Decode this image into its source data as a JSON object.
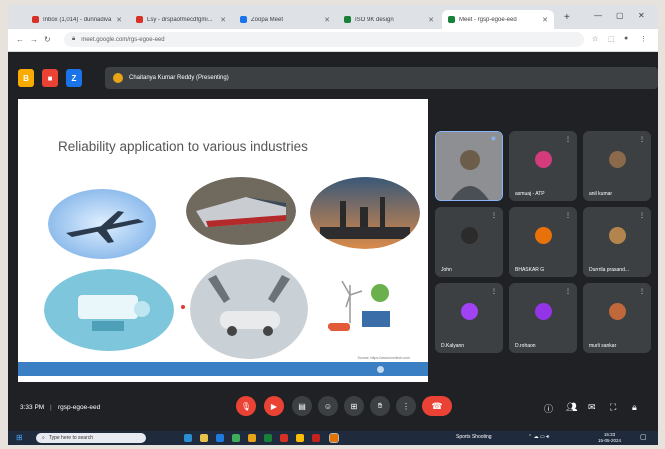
{
  "browser": {
    "tabs": [
      {
        "title": "Inbox (1,014) - dunnadiva",
        "color": "#d93025"
      },
      {
        "title": "Lsy - drspaofmecdfgmi...",
        "color": "#d93025"
      },
      {
        "title": "Zoopa Meet",
        "color": "#1a73e8"
      },
      {
        "title": "ISO 9K design",
        "color": "#188038"
      },
      {
        "title": "Meet - rgsp-egoe-eed",
        "color": "#188038"
      }
    ],
    "new_tab": "+",
    "window_controls": {
      "minimize": "—",
      "maximize": "▢",
      "close": "✕"
    },
    "url": "meet.google.com/rgs-egoe-eed"
  },
  "meet": {
    "presenter_label": "Chaitanya Kumar Reddy (Presenting)",
    "top_buttons": [
      {
        "label": "B",
        "color": "#f9ab00"
      },
      {
        "label": "■",
        "color": "#ea4335"
      },
      {
        "label": "Z",
        "color": "#1a73e8"
      }
    ],
    "slide": {
      "title": "Reliability application to various industries",
      "caption": "Source: https://www.iomitech.com"
    },
    "participants": [
      {
        "name": "",
        "avatar": "#6b5d4a",
        "video": true
      },
      {
        "name": "asmuaj - ATP",
        "avatar": "#d33b7a"
      },
      {
        "name": "anil kumar",
        "avatar": "#8a6a4a"
      },
      {
        "name": "John",
        "avatar": "#2b2b2b"
      },
      {
        "name": "BHASKAR G",
        "avatar": "#e8710a"
      },
      {
        "name": "Durrrila prasand...",
        "avatar": "#b4844f"
      },
      {
        "name": "D.Kalyann",
        "avatar": "#a142f4"
      },
      {
        "name": "D.rohaon",
        "avatar": "#9334e6"
      },
      {
        "name": "murli sankar",
        "avatar": "#c0683b"
      }
    ],
    "time": "3:33 PM",
    "meeting_code": "rgsp-egoe-eed"
  },
  "taskbar": {
    "search_placeholder": "Type here to search",
    "weather": "Sports Shooting",
    "time": "15:33",
    "date": "15-05-2024"
  }
}
